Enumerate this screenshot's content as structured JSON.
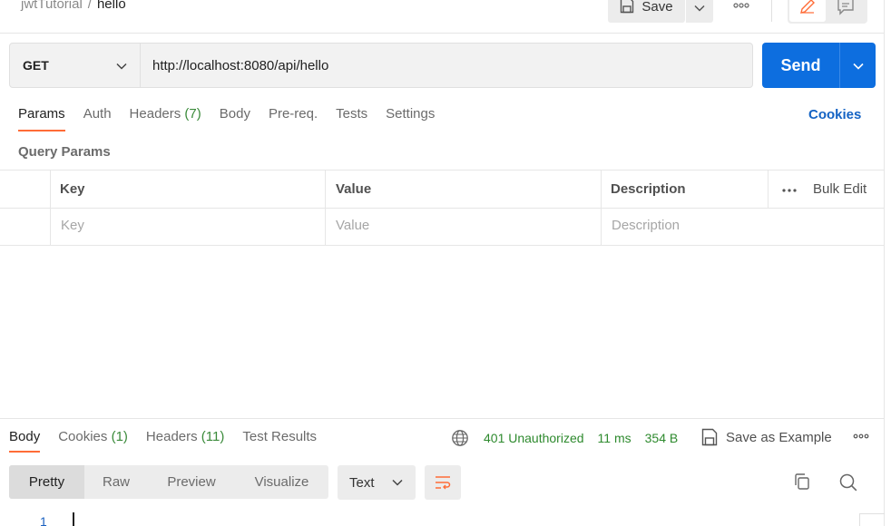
{
  "breadcrumb": {
    "parent": "jwtTutorial",
    "separator": "/",
    "current": "hello"
  },
  "toolbar": {
    "save_label": "Save"
  },
  "request": {
    "method": "GET",
    "url": "http://localhost:8080/api/hello",
    "send_label": "Send"
  },
  "request_tabs": [
    {
      "label": "Params"
    },
    {
      "label": "Auth"
    },
    {
      "label": "Headers",
      "count": "(7)"
    },
    {
      "label": "Body"
    },
    {
      "label": "Pre-req."
    },
    {
      "label": "Tests"
    },
    {
      "label": "Settings"
    }
  ],
  "cookies_link": "Cookies",
  "query_params": {
    "title": "Query Params",
    "columns": {
      "key": "Key",
      "value": "Value",
      "description": "Description"
    },
    "bulk_edit": "Bulk Edit",
    "placeholders": {
      "key": "Key",
      "value": "Value",
      "description": "Description"
    }
  },
  "response_tabs": [
    {
      "label": "Body"
    },
    {
      "label": "Cookies",
      "count": "(1)"
    },
    {
      "label": "Headers",
      "count": "(11)"
    },
    {
      "label": "Test Results"
    }
  ],
  "response": {
    "status": "401 Unauthorized",
    "time": "11 ms",
    "size": "354 B",
    "save_example": "Save as Example"
  },
  "view_modes": [
    "Pretty",
    "Raw",
    "Preview",
    "Visualize"
  ],
  "format": "Text",
  "editor": {
    "line_number": "1"
  },
  "colors": {
    "accent": "#ff6c37",
    "send": "#0d6edf",
    "status_ok": "#2e8a2e",
    "link": "#1463c4"
  }
}
